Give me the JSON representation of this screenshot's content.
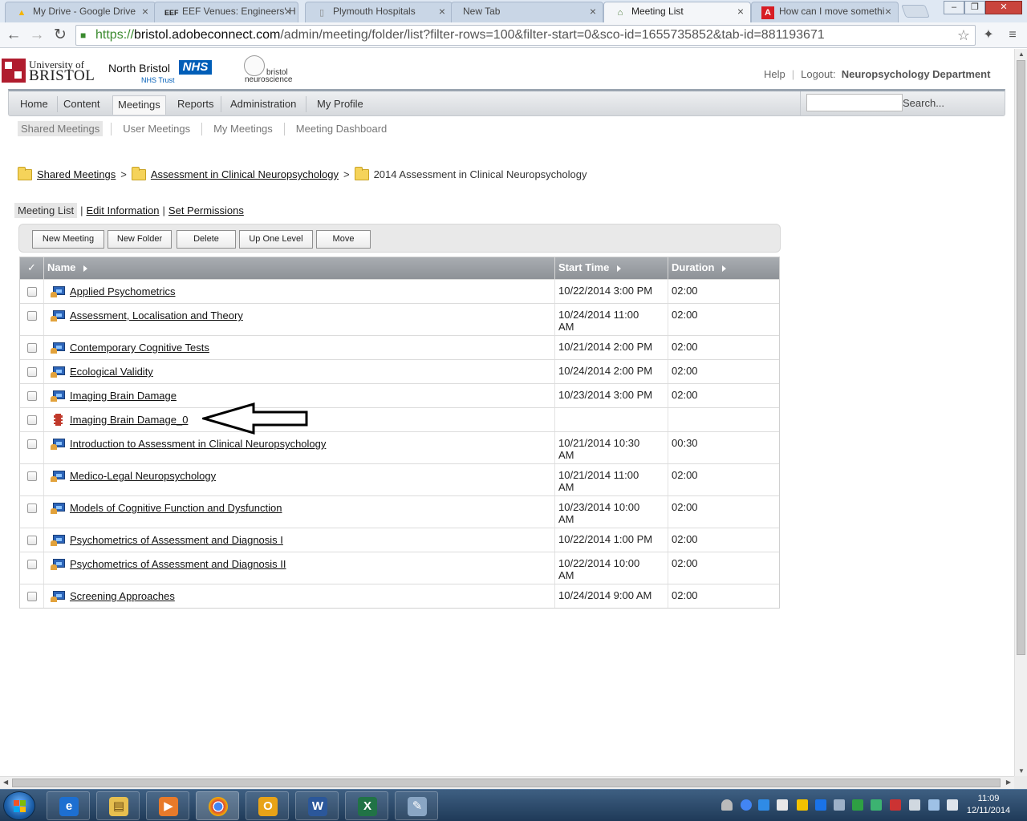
{
  "browser": {
    "tabs": [
      {
        "title": "My Drive - Google Drive",
        "icon": "google-drive-icon"
      },
      {
        "title": "EEF Venues: Engineers' H",
        "icon": "eef-icon"
      },
      {
        "title": "Plymouth Hospitals",
        "icon": "page-icon"
      },
      {
        "title": "New Tab",
        "icon": ""
      },
      {
        "title": "Meeting List",
        "icon": "adobe-connect-icon",
        "active": true
      },
      {
        "title": "How can I move somethi",
        "icon": "adobe-icon"
      }
    ],
    "url": {
      "scheme": "https://",
      "host": "bristol.adobeconnect.com",
      "path": "/admin/meeting/folder/list?filter-rows=100&filter-start=0&sco-id=1655735852&tab-id=881193671"
    }
  },
  "header": {
    "logo_uob_line1": "University of",
    "logo_uob_line2": "BRISTOL",
    "logo_nbt_name": "North Bristol",
    "logo_nbt_badge": "NHS",
    "logo_nbt_sub": "NHS Trust",
    "logo_bn_line1": "bristol",
    "logo_bn_line2": "neuroscience",
    "help_label": "Help",
    "logout_label": "Logout:",
    "user_name": "Neuropsychology Department"
  },
  "nav": {
    "items": [
      "Home",
      "Content",
      "Meetings",
      "Reports",
      "Administration",
      "My Profile"
    ],
    "active": "Meetings",
    "search_label": "Search..."
  },
  "subnav": {
    "items": [
      "Shared Meetings",
      "User Meetings",
      "My Meetings",
      "Meeting Dashboard"
    ],
    "active": "Shared Meetings"
  },
  "breadcrumb": [
    "Shared Meetings",
    "Assessment in Clinical Neuropsychology",
    "2014 Assessment in Clinical Neuropsychology"
  ],
  "view_tabs": [
    "Meeting List",
    "Edit Information",
    "Set Permissions"
  ],
  "actions": [
    "New Meeting",
    "New Folder",
    "Delete",
    "Up One Level",
    "Move"
  ],
  "table": {
    "columns": [
      "Name",
      "Start Time",
      "Duration"
    ],
    "rows": [
      {
        "name": "Applied Psychometrics",
        "start_line1": "10/22/2014 3:00 PM",
        "start_line2": "",
        "duration": "02:00",
        "type": "meeting"
      },
      {
        "name": "Assessment, Localisation and Theory",
        "start_line1": "10/24/2014 11:00",
        "start_line2": "AM",
        "duration": "02:00",
        "type": "meeting"
      },
      {
        "name": "Contemporary Cognitive Tests",
        "start_line1": "10/21/2014 2:00 PM",
        "start_line2": "",
        "duration": "02:00",
        "type": "meeting"
      },
      {
        "name": "Ecological Validity",
        "start_line1": "10/24/2014 2:00 PM",
        "start_line2": "",
        "duration": "02:00",
        "type": "meeting"
      },
      {
        "name": "Imaging Brain Damage",
        "start_line1": "10/23/2014 3:00 PM",
        "start_line2": "",
        "duration": "02:00",
        "type": "meeting"
      },
      {
        "name": "Imaging Brain Damage_0",
        "start_line1": "",
        "start_line2": "",
        "duration": "",
        "type": "recording"
      },
      {
        "name": "Introduction to Assessment in Clinical Neuropsychology",
        "start_line1": "10/21/2014 10:30",
        "start_line2": "AM",
        "duration": "00:30",
        "type": "meeting"
      },
      {
        "name": "Medico-Legal Neuropsychology",
        "start_line1": "10/21/2014 11:00",
        "start_line2": "AM",
        "duration": "02:00",
        "type": "meeting"
      },
      {
        "name": "Models of Cognitive Function and Dysfunction",
        "start_line1": "10/23/2014 10:00",
        "start_line2": "AM",
        "duration": "02:00",
        "type": "meeting"
      },
      {
        "name": "Psychometrics of Assessment and Diagnosis I",
        "start_line1": "10/22/2014 1:00 PM",
        "start_line2": "",
        "duration": "02:00",
        "type": "meeting"
      },
      {
        "name": "Psychometrics of Assessment and Diagnosis II",
        "start_line1": "10/22/2014 10:00",
        "start_line2": "AM",
        "duration": "02:00",
        "type": "meeting"
      },
      {
        "name": "Screening Approaches",
        "start_line1": "10/24/2014 9:00 AM",
        "start_line2": "",
        "duration": "02:00",
        "type": "meeting"
      }
    ]
  },
  "taskbar": {
    "apps": [
      "internet-explorer-icon",
      "file-explorer-icon",
      "media-player-icon",
      "chrome-icon",
      "outlook-icon",
      "word-icon",
      "excel-icon",
      "paint-icon"
    ],
    "time": "11:09",
    "date": "12/11/2014"
  }
}
